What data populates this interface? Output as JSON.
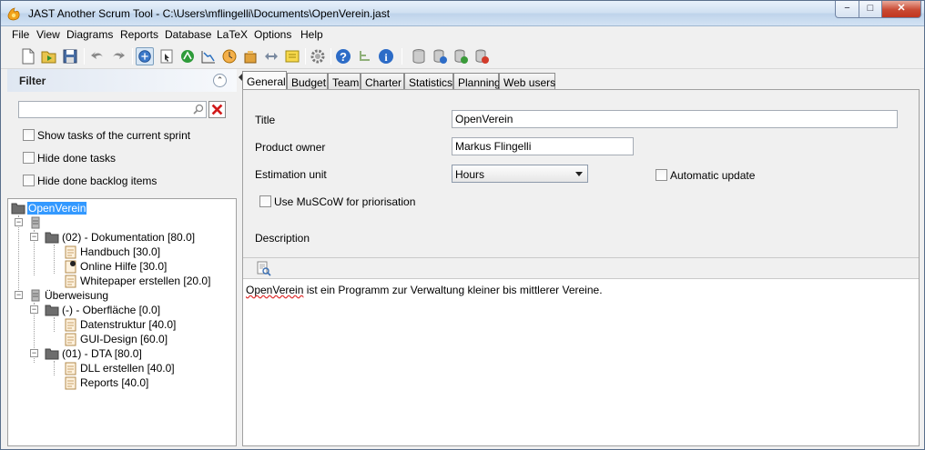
{
  "window": {
    "title": "JAST Another Scrum Tool  -  C:\\Users\\mflingelli\\Documents\\OpenVerein.jast",
    "controls": {
      "minimize": "−",
      "maximize": "□",
      "close": "✕"
    }
  },
  "menu": {
    "items": [
      "File",
      "View",
      "Diagrams",
      "Reports",
      "Database",
      "LaTeX",
      "Options",
      "Help"
    ]
  },
  "toolbar": {
    "buttons": [
      "new-file-icon",
      "open-folder-icon",
      "save-icon",
      "undo-icon",
      "redo-icon",
      "select-mode-icon",
      "cursor-icon",
      "sprint-icon",
      "burndown-icon",
      "clock-icon",
      "export-icon",
      "transfer-icon",
      "note-icon",
      "settings-gear-icon",
      "help-icon",
      "tree-icon",
      "info-icon",
      "database-icon",
      "database-connect-icon",
      "database-sync-icon",
      "database-delete-icon"
    ]
  },
  "filter": {
    "title": "Filter",
    "search_value": "",
    "show_current_sprint": "Show tasks of the current sprint",
    "hide_done_tasks": "Hide done tasks",
    "hide_done_backlog": "Hide done backlog items"
  },
  "tree": {
    "root": "OpenVerein",
    "items": {
      "doc_group": "(02) - Dokumentation [80.0]",
      "handbuch": "Handbuch [30.0]",
      "online_hilfe": "Online Hilfe [30.0]",
      "whitepaper": "Whitepaper erstellen [20.0]",
      "ueberweisung": "Überweisung",
      "oberflaeche": "(-) - Oberfläche [0.0]",
      "datenstruktur": "Datenstruktur [40.0]",
      "gui_design": "GUI-Design [60.0]",
      "dta": "(01) - DTA [80.0]",
      "dll": "DLL erstellen [40.0]",
      "reports": "Reports [40.0]"
    }
  },
  "tabs": [
    "General",
    "Budget",
    "Team",
    "Charter",
    "Statistics",
    "Planning",
    "Web users"
  ],
  "active_tab": "General",
  "general": {
    "title_label": "Title",
    "title_value": "OpenVerein",
    "owner_label": "Product owner",
    "owner_value": "Markus Flingelli",
    "unit_label": "Estimation unit",
    "unit_value": "Hours",
    "auto_update": "Automatic update",
    "muscow": "Use MuSCoW for priorisation",
    "description_label": "Description",
    "description_first": "OpenVerein",
    "description_rest": " ist ein Programm zur Verwaltung kleiner bis mittlerer Vereine."
  }
}
